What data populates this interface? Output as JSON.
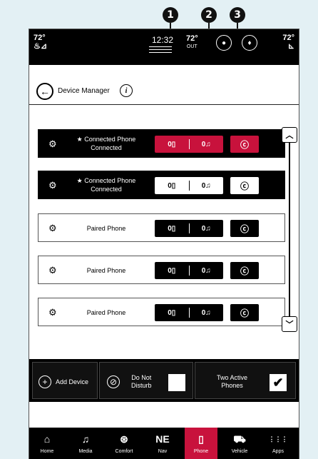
{
  "callouts": [
    "1",
    "2",
    "3"
  ],
  "status_bar": {
    "left_temp": "72°",
    "time": "12:32",
    "out_temp": "72°",
    "out_label": "OUT",
    "right_temp": "72°"
  },
  "top_bar": {
    "title": "Device Manager",
    "info_glyph": "i",
    "back_glyph": "←"
  },
  "devices": [
    {
      "star": true,
      "name": "Connected Phone",
      "status": "Connected",
      "phone_glyph": "0▯",
      "media_glyph": "0♫",
      "option_glyph": "ⓒ"
    },
    {
      "star": true,
      "name": "Connected Phone",
      "status": "Connected",
      "phone_glyph": "0▯",
      "media_glyph": "0♫",
      "option_glyph": "ⓒ"
    },
    {
      "star": false,
      "name": "Paired Phone",
      "status": "",
      "phone_glyph": "0▯",
      "media_glyph": "0♫",
      "option_glyph": "ⓒ"
    },
    {
      "star": false,
      "name": "Paired Phone",
      "status": "",
      "phone_glyph": "0▯",
      "media_glyph": "0♫",
      "option_glyph": "ⓒ"
    },
    {
      "star": false,
      "name": "Paired Phone",
      "status": "",
      "phone_glyph": "0▯",
      "media_glyph": "0♫",
      "option_glyph": "ⓒ"
    }
  ],
  "bottom_options": {
    "add_device": "Add Device",
    "do_not_disturb_line1": "Do Not",
    "do_not_disturb_line2": "Disturb",
    "two_active_line1": "Two Active",
    "two_active_line2": "Phones",
    "check_glyph": "✔"
  },
  "nav": [
    {
      "icon": "home-icon",
      "glyph": "⌂",
      "label": "Home"
    },
    {
      "icon": "music-note-icon",
      "glyph": "♫",
      "label": "Media"
    },
    {
      "icon": "climate-icon",
      "glyph": "⊛",
      "label": "Comfort"
    },
    {
      "icon": "compass-icon",
      "glyph": "NE",
      "label": "Nav"
    },
    {
      "icon": "phone-icon",
      "glyph": "▯",
      "label": "Phone"
    },
    {
      "icon": "car-icon",
      "glyph": "⛟",
      "label": "Vehicle"
    },
    {
      "icon": "apps-grid-icon",
      "glyph": "⋮⋮⋮",
      "label": "Apps"
    }
  ],
  "active_nav": "Phone",
  "colors": {
    "accent": "#c8123c",
    "background": "#e3f0f4",
    "bar": "#000000"
  }
}
